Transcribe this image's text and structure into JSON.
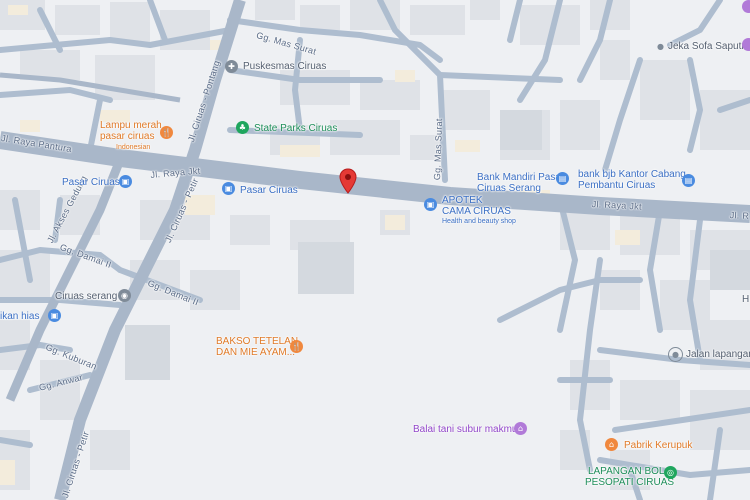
{
  "map": {
    "colors": {
      "background": "#eef0f3",
      "road": "#aebdcf",
      "main_road": "#a9b7c9",
      "building": "#dfe2e7",
      "block": "#d4d9df",
      "pin": "#e53935"
    },
    "streets": {
      "raya_pantura": "Jl. Raya Pantura",
      "raya_jkt_left": "Jl. Raya Jkt",
      "raya_jkt_right": "Jl. Raya Jkt",
      "raya_jkt_edge": "Jl. R",
      "ciruas_pontang": "Jl. Ciruas - Pontang",
      "ciruas_petir_top": "Jl. Ciruas - Petir",
      "ciruas_petir_bottom": "Jl. Ciruas - Petir",
      "akses_gedung": "Jl. Akses Gedung",
      "gg_mas_surat_top": "Gg. Mas Surat",
      "gg_mas_surat_vert": "Gg. Mas Surat",
      "gg_damai_ii": "Gg. Damai II",
      "gg_damai_ii_b": "Gg. Damai II",
      "gg_kuburan": "Gg. Kuburan",
      "gg_anwar": "Gg. Anwar"
    },
    "pois": {
      "puskesmas": "Puskesmas Ciruas",
      "lampu_merah": "Lampu merah\npasar ciruas",
      "lampu_merah_sub": "Indonesian",
      "state_parks": "State Parks Ciruas",
      "pasar_left": "Pasar Ciruas",
      "pasar_center": "Pasar Ciruas",
      "apotek": "APOTEK\nCAMA CIRUAS",
      "apotek_sub": "Health and beauty shop",
      "bank_mandiri": "Bank Mandiri Pasar\nCiruas Serang",
      "bank_bjb": "bank bjb Kantor Cabang\nPembantu Ciruas",
      "jeka": "Jeka Sofa Saputra",
      "ciruas_serang": "Ciruas serang",
      "ikan_hias": "ikan hias",
      "bakso": "BAKSO TETELAN\nDAN MIE AYAM...",
      "jalan_lapangan": "Jalan lapangan",
      "balai_tani": "Balai tani subur makmur",
      "pabrik": "Pabrik Kerupuk",
      "lapangan_bola": "LAPANGAN BOLA\nPESOPATI CIRUAS",
      "h_label": "H"
    }
  }
}
